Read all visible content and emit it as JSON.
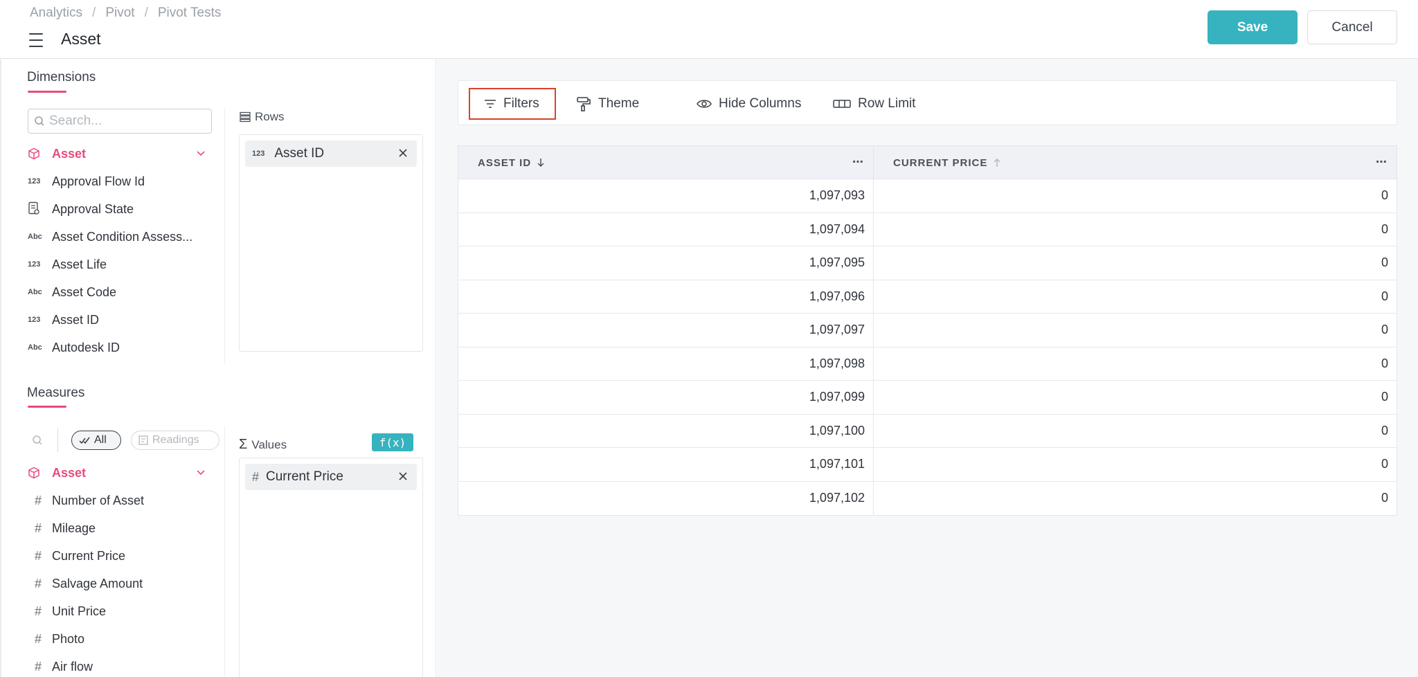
{
  "breadcrumb": [
    "Analytics",
    "Pivot",
    "Pivot Tests"
  ],
  "breadcrumb_sep": "/",
  "title": "Asset",
  "actions": {
    "save": "Save",
    "cancel": "Cancel"
  },
  "colors": {
    "accent": "#36b3bf",
    "pink": "#e84a7a",
    "highlight": "#d9412b"
  },
  "dimensions": {
    "heading": "Dimensions",
    "search_placeholder": "Search...",
    "group": "Asset",
    "fields": [
      {
        "type": "123",
        "label": "Approval Flow Id"
      },
      {
        "type": "doc-icon",
        "label": "Approval State"
      },
      {
        "type": "Abc",
        "label": "Asset Condition Assess..."
      },
      {
        "type": "123",
        "label": "Asset Life"
      },
      {
        "type": "Abc",
        "label": "Asset Code"
      },
      {
        "type": "123",
        "label": "Asset ID"
      },
      {
        "type": "Abc",
        "label": "Autodesk ID"
      }
    ]
  },
  "rows_zone": {
    "label": "Rows",
    "chip_type": "123",
    "chip": "Asset ID"
  },
  "measures": {
    "heading": "Measures",
    "pill_all": "All",
    "pill_readings": "Readings",
    "group": "Asset",
    "fields": [
      "Number of Asset",
      "Mileage",
      "Current Price",
      "Salvage Amount",
      "Unit Price",
      "Photo",
      "Air flow"
    ]
  },
  "values_zone": {
    "label": "Values",
    "fx": "f(x)",
    "chip": "Current Price"
  },
  "toolbar": {
    "filters": "Filters",
    "theme": "Theme",
    "hide_columns": "Hide Columns",
    "row_limit": "Row Limit"
  },
  "table": {
    "columns": [
      "ASSET ID",
      "CURRENT PRICE"
    ],
    "rows": [
      [
        "1,097,093",
        "0"
      ],
      [
        "1,097,094",
        "0"
      ],
      [
        "1,097,095",
        "0"
      ],
      [
        "1,097,096",
        "0"
      ],
      [
        "1,097,097",
        "0"
      ],
      [
        "1,097,098",
        "0"
      ],
      [
        "1,097,099",
        "0"
      ],
      [
        "1,097,100",
        "0"
      ],
      [
        "1,097,101",
        "0"
      ],
      [
        "1,097,102",
        "0"
      ]
    ]
  }
}
